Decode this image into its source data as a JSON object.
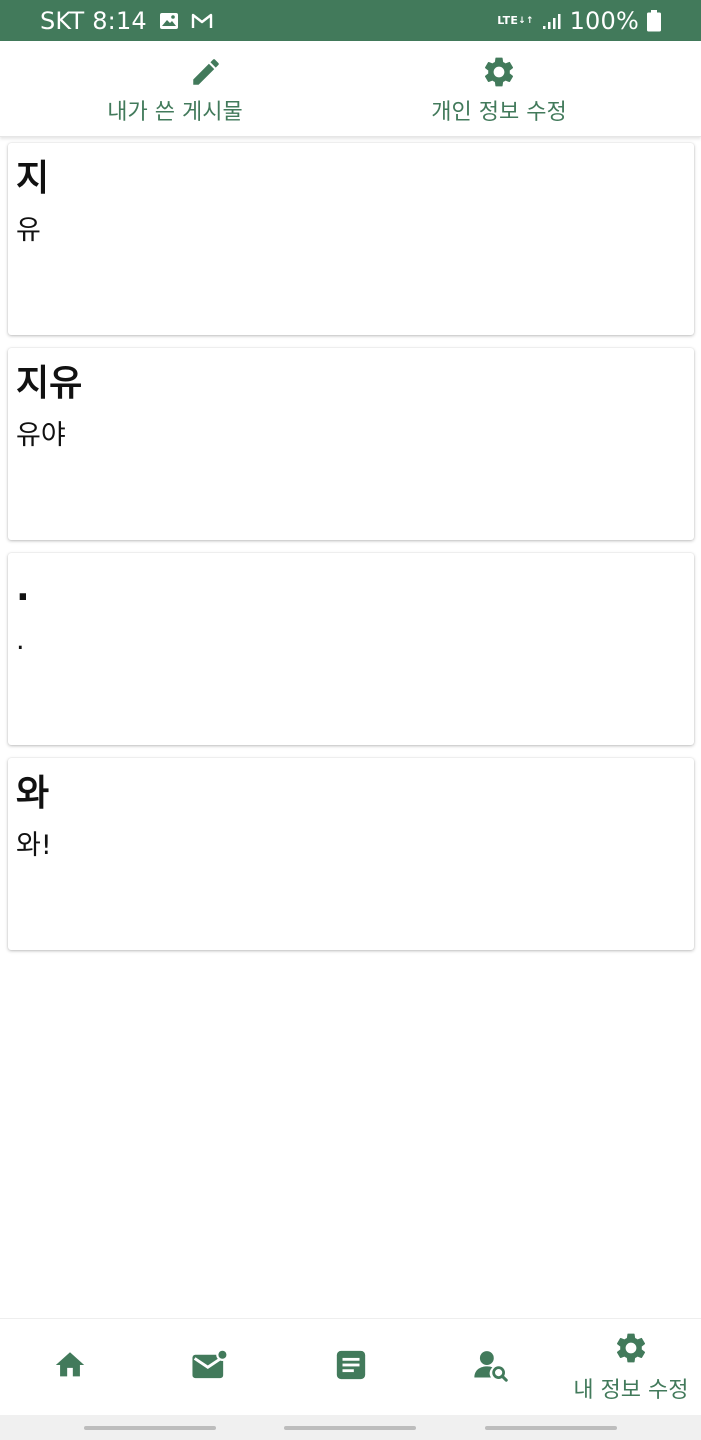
{
  "colors": {
    "accent": "#427a5b"
  },
  "status_bar": {
    "carrier_time": "SKT 8:14",
    "network": "LTE",
    "battery": "100%",
    "icons": [
      "image-icon",
      "gmail-icon",
      "lte-icon",
      "signal-icon",
      "battery-icon"
    ]
  },
  "top_tabs": [
    {
      "label": "내가 쓴 게시물",
      "icon": "pencil-icon"
    },
    {
      "label": "개인 정보 수정",
      "icon": "gear-icon"
    }
  ],
  "posts": [
    {
      "title": "지",
      "body": "유"
    },
    {
      "title": "지유",
      "body": "유야"
    },
    {
      "title": ".",
      "body": "."
    },
    {
      "title": "와",
      "body": "와!"
    }
  ],
  "bottom_nav": {
    "items": [
      {
        "icon": "home-icon",
        "label": ""
      },
      {
        "icon": "mail-notification-icon",
        "label": ""
      },
      {
        "icon": "document-icon",
        "label": ""
      },
      {
        "icon": "user-search-icon",
        "label": ""
      },
      {
        "icon": "gear-icon",
        "label": "내 정보 수정"
      }
    ]
  }
}
